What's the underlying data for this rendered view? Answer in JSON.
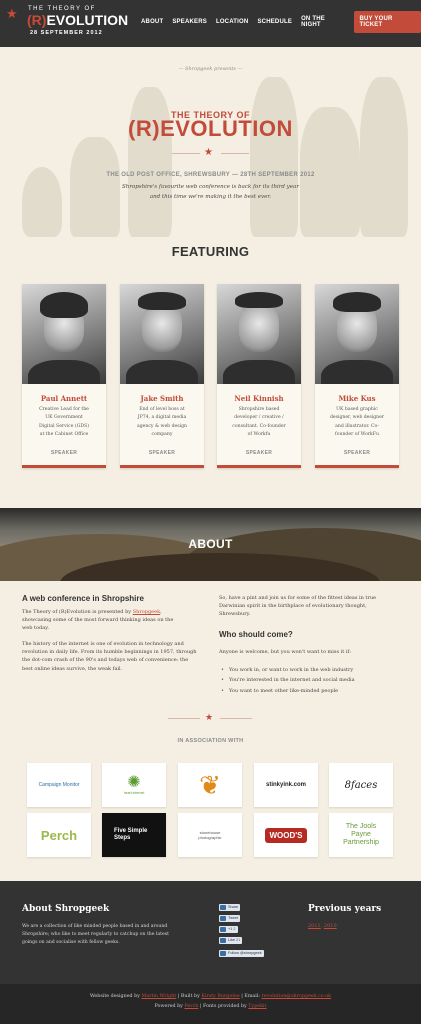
{
  "header": {
    "logo_top": "THE THEORY OF",
    "logo_r": "(R)",
    "logo_rest": "EVOLUTION",
    "logo_date": "28 SEPTEMBER 2012",
    "nav": [
      "ABOUT",
      "SPEAKERS",
      "LOCATION",
      "SCHEDULE",
      "ON THE NIGHT"
    ],
    "buy_label": "BUY YOUR TICKET"
  },
  "hero": {
    "presents": "— Shropgeek presents —",
    "title_line1": "THE THEORY OF",
    "title_line2": "(R)EVOLUTION",
    "venue": "THE OLD POST OFFICE, SHREWSBURY — 28TH SEPTEMBER 2012",
    "desc_line1": "Shropshire's favourite web conference is back for its third year",
    "desc_line2": "and this time we're making it the best ever."
  },
  "featuring": {
    "title": "FEATURING",
    "speakers": [
      {
        "name": "Paul Annett",
        "bio": [
          "Creative Lead for the",
          "UK Government",
          "Digital Service (GDS)",
          "at the Cabinet Office"
        ],
        "role": "SPEAKER"
      },
      {
        "name": "Jake Smith",
        "bio": [
          "End of level boss at",
          "JP74, a digital media",
          "agency & web design",
          "company"
        ],
        "role": "SPEAKER"
      },
      {
        "name": "Neil Kinnish",
        "bio": [
          "Shropshire based",
          "developer / creative /",
          "consultant. Co-founder",
          "of Workfu"
        ],
        "role": "SPEAKER"
      },
      {
        "name": "Mike Kus",
        "bio": [
          "UK based graphic",
          "designer, web designer",
          "and illustrator. Co-",
          "founder of WorkFu"
        ],
        "role": "SPEAKER"
      }
    ]
  },
  "about": {
    "title": "ABOUT",
    "heading": "A web conference in Shropshire",
    "p1_pre": "The Theory of (R)Evolution is presented by ",
    "p1_link": "Shropgeek",
    "p1_lines": [
      "showcasing some of the most forward thinking ideas on the",
      "web today."
    ],
    "p2_lines": [
      "The history of the internet is one of evolution in technology and",
      "revolution in daily life. From its humble beginnings in 1957, through",
      "the dot-com crash of the 90's and todays web of convenience: the",
      "best online ideas survive, the weak fail."
    ],
    "p3_lines": [
      "So, have a pint and join us for some of the fittest ideas in true",
      "Darwinian spirit in the birthplace of evolutionary thought,",
      "Shrewsbury."
    ],
    "who_heading": "Who should come?",
    "who_intro": "Anyone is welcome, but you won't want to miss it if:",
    "who_list": [
      "You work in, or want to work in the web industry",
      "You're interested in the internet and social media",
      "You want to meet other like-minded people"
    ]
  },
  "sponsors": {
    "title": "IN ASSOCIATION WITH",
    "items": [
      "Campaign Monitor",
      "heart internet",
      "",
      "stinkyink.com",
      "8faces",
      "Perch",
      "Five Simple Steps",
      "stonehouse photographic",
      "WOOD'S",
      "The Jools Payne Partnership"
    ]
  },
  "footer": {
    "about_heading": "About Shropgeek",
    "about_lines": [
      "We are a collection of like minded people based in and around",
      "Shropshire; who like to meet regularly to catchup on the latest",
      "goings on and socialise with fellow geeks."
    ],
    "social": [
      "Share",
      "Tweet",
      "+1",
      "Like",
      "Follow @shropgeek"
    ],
    "like_count": "21",
    "plus_count": "2",
    "prev_heading": "Previous years",
    "prev_years": [
      "2011",
      "2010"
    ],
    "credits_line1_pre": "Website designed by ",
    "designer": "Martin Wright",
    "built_pre": " | Built by ",
    "builder": "Kirsty Burgoine",
    "email_pre": " | Email: ",
    "email": "revolution@shropgeek.co.uk",
    "powered_pre": "Powered by ",
    "powered": "Perch",
    "fonts_pre": " | Fonts provided by ",
    "fonts": "Typekit"
  },
  "colors": {
    "accent": "#c24b3a",
    "background": "#f4efe2",
    "header": "#333333"
  }
}
